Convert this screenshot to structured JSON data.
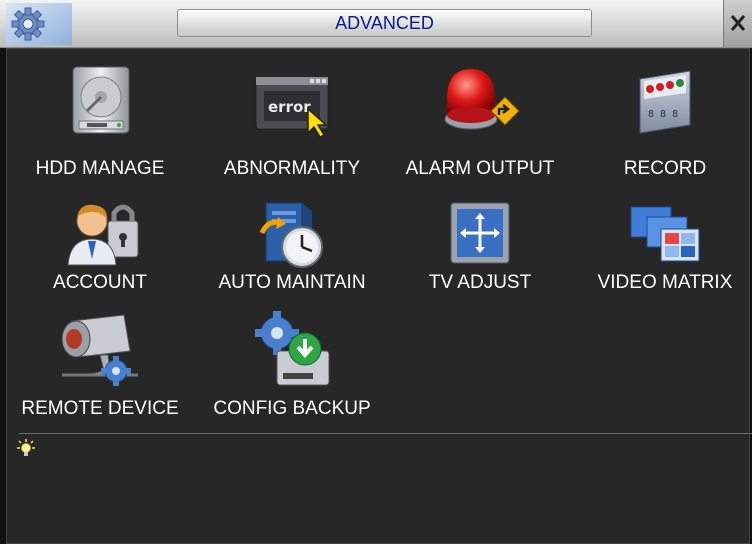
{
  "window": {
    "title": "ADVANCED"
  },
  "menu_items": [
    {
      "label": "HDD MANAGE"
    },
    {
      "label": "ABNORMALITY",
      "icon_text": "error"
    },
    {
      "label": "ALARM OUTPUT"
    },
    {
      "label": "RECORD"
    },
    {
      "label": "ACCOUNT"
    },
    {
      "label": "AUTO MAINTAIN"
    },
    {
      "label": "TV ADJUST"
    },
    {
      "label": "VIDEO MATRIX"
    },
    {
      "label": "REMOTE DEVICE"
    },
    {
      "label": "CONFIG BACKUP"
    }
  ],
  "icons": [
    "gear-icon",
    "close-icon",
    "hdd-icon",
    "error-screen-icon",
    "alarm-light-icon",
    "record-icon",
    "account-lock-icon",
    "auto-maintain-icon",
    "tv-adjust-icon",
    "video-matrix-icon",
    "remote-camera-icon",
    "config-backup-icon",
    "lightbulb-icon"
  ],
  "colors": {
    "title_text": "#0a1896",
    "background": "#272727",
    "label_text": "#ffffff"
  }
}
